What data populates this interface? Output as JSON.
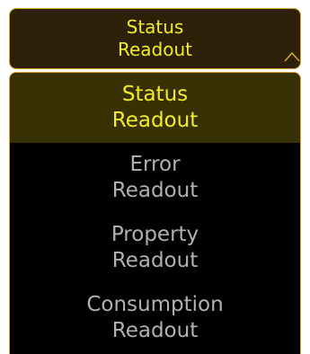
{
  "dropdown": {
    "selected_label": "Status\nReadout",
    "caret_icon": "caret-up-icon"
  },
  "menu": {
    "items": [
      {
        "label": "Status\nReadout",
        "selected": true
      },
      {
        "label": "Error\nReadout",
        "selected": false
      },
      {
        "label": "Property\nReadout",
        "selected": false
      },
      {
        "label": "Consumption\nReadout",
        "selected": false
      }
    ]
  },
  "colors": {
    "accent_border": "#d9a62a",
    "selected_text": "#f3ec28",
    "unselected_text": "#b1b1b1",
    "button_bg": "#2c2108",
    "selected_row_bg": "#383106",
    "menu_bg": "#010101"
  }
}
